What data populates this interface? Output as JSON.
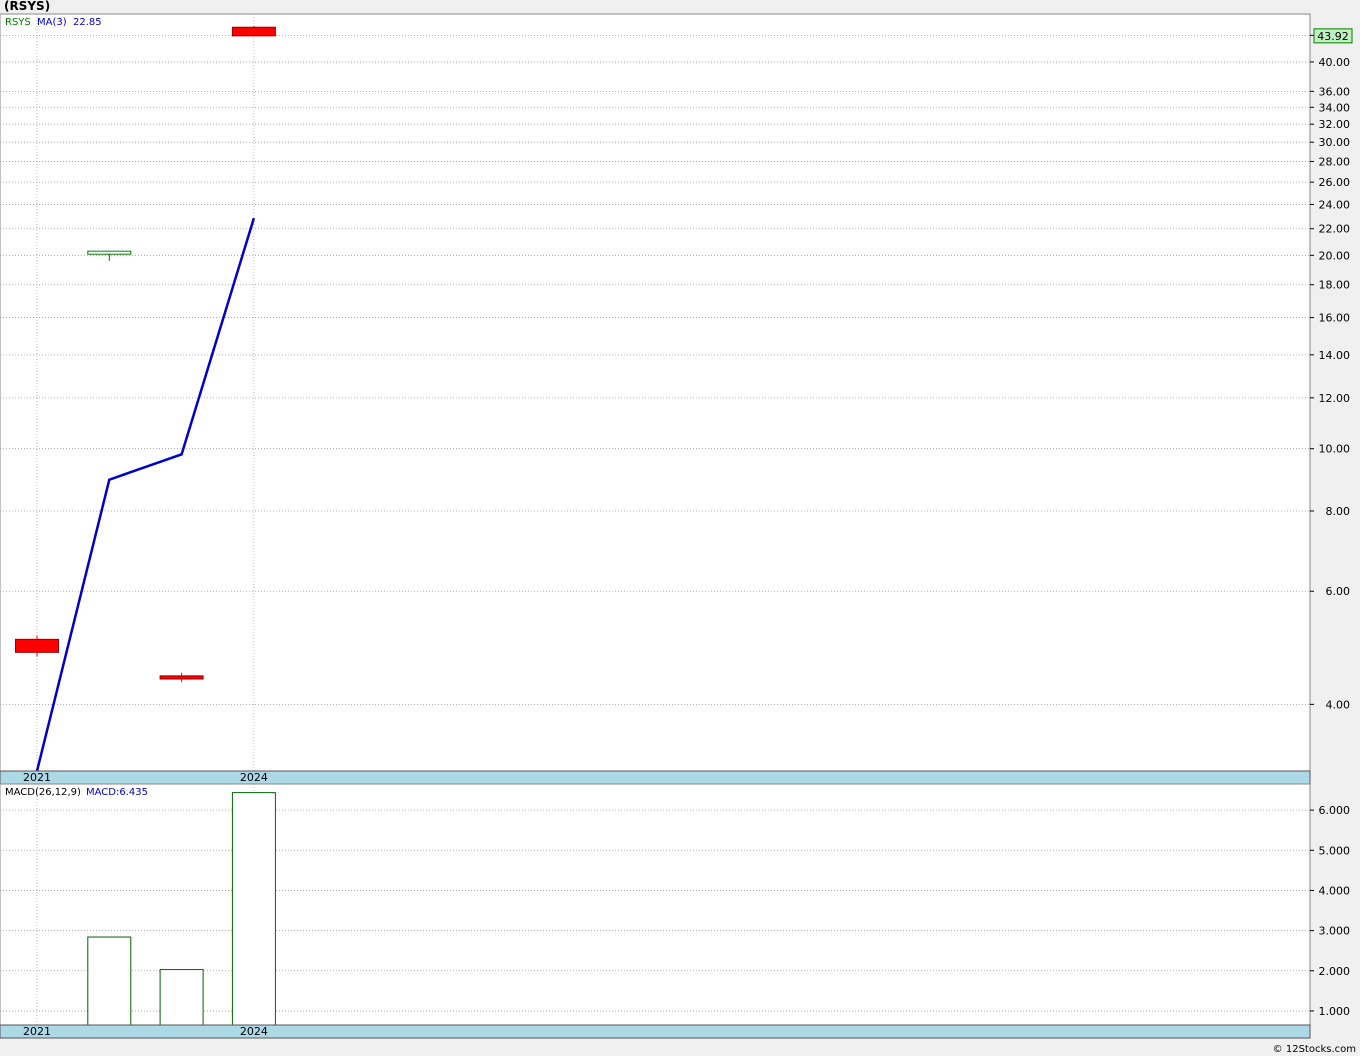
{
  "chart_title": "(RSYS)",
  "copyright": "© 12Stocks.com",
  "chart_data": [
    {
      "type": "candlestick",
      "scale": "log",
      "legend": {
        "symbol": "RSYS",
        "ma_label": "MA(3)",
        "ma_value": "22.85",
        "symbol_color": "#008000",
        "ma_color": "#0000cc"
      },
      "ylim": [
        3.15,
        47.5
      ],
      "yticks": [
        4.0,
        6.0,
        8.0,
        10.0,
        12.0,
        14.0,
        16.0,
        18.0,
        20.0,
        22.0,
        24.0,
        26.0,
        28.0,
        30.0,
        32.0,
        34.0,
        36.0,
        40.0,
        44.0
      ],
      "ytick_labels": [
        "4.00",
        "6.00",
        "8.00",
        "10.00",
        "12.00",
        "14.00",
        "16.00",
        "18.00",
        "20.00",
        "22.00",
        "24.00",
        "26.00",
        "28.00",
        "30.00",
        "32.00",
        "34.00",
        "36.00",
        "40.00",
        "44.00"
      ],
      "last_price": "43.92",
      "last_price_value": 43.92,
      "x_year_labels": [
        {
          "label": "2021",
          "index": 0
        },
        {
          "label": "2024",
          "index": 3
        }
      ],
      "candles": [
        {
          "open": 5.05,
          "high": 5.12,
          "low": 4.75,
          "close": 4.82,
          "color": "#ff0000"
        },
        {
          "open": 20.1,
          "high": 20.3,
          "low": 19.6,
          "close": 20.3,
          "color": "#008000"
        },
        {
          "open": 4.43,
          "high": 4.48,
          "low": 4.33,
          "close": 4.38,
          "color": "#ff0000"
        },
        {
          "open": 45.3,
          "high": 45.5,
          "low": 43.9,
          "close": 43.92,
          "color": "#ff0000"
        }
      ],
      "ma": {
        "name": "MA(3)",
        "values": [
          3.15,
          8.95,
          9.8,
          22.85
        ],
        "color": "#0000cc"
      }
    },
    {
      "type": "bar",
      "legend": {
        "name": "MACD(26,12,9)",
        "value_label": "MACD:6.435"
      },
      "ylim": [
        0.65,
        6.65
      ],
      "yticks": [
        1.0,
        2.0,
        3.0,
        4.0,
        5.0,
        6.0
      ],
      "ytick_labels": [
        "1.000",
        "2.000",
        "3.000",
        "4.000",
        "5.000",
        "6.000"
      ],
      "values": [
        null,
        2.84,
        2.03,
        6.435
      ],
      "bar_color": "#006400",
      "x_year_labels": [
        {
          "label": "2021",
          "index": 0
        },
        {
          "label": "2024",
          "index": 3
        }
      ]
    }
  ]
}
